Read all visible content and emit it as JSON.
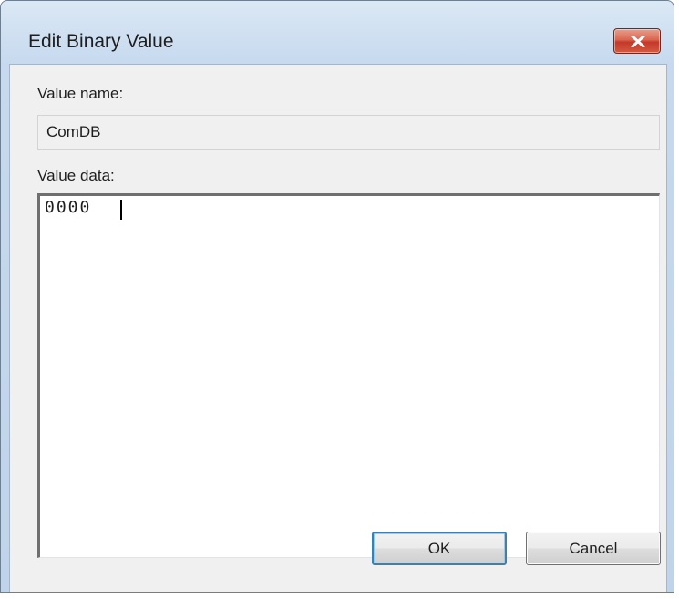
{
  "window": {
    "title": "Edit Binary Value",
    "close_icon": "close-icon"
  },
  "form": {
    "value_name_label": "Value name:",
    "value_name": "ComDB",
    "value_data_label": "Value data:",
    "value_data_offset": "0000"
  },
  "buttons": {
    "ok_label": "OK",
    "cancel_label": "Cancel"
  },
  "colors": {
    "title_bar": "#c6d9ee",
    "close_button": "#c4392a",
    "client_background": "#f0f0f0",
    "default_button_border": "#3c7fb1"
  }
}
